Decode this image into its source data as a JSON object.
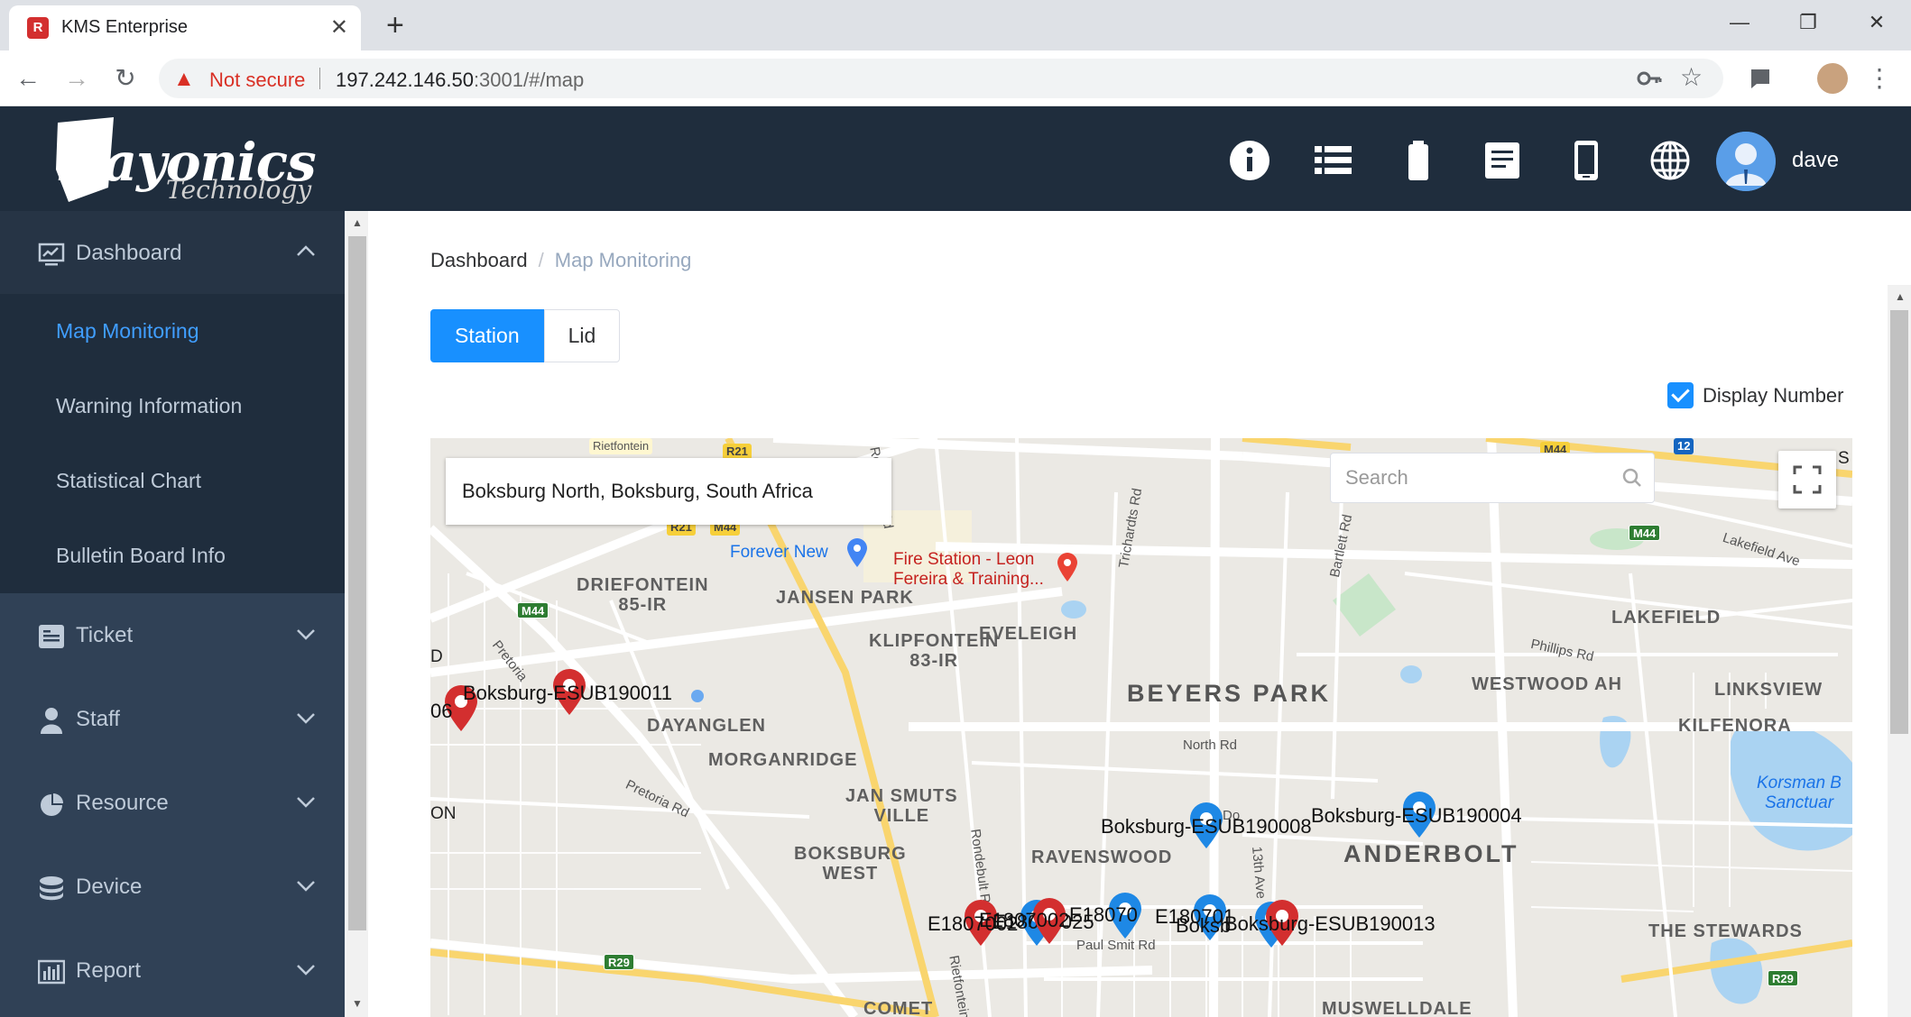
{
  "browser": {
    "tab_title": "KMS Enterprise",
    "tab_favicon_letter": "R",
    "security_label": "Not secure",
    "url_host": "197.242.146.50",
    "url_rest": ":3001/#/map",
    "window_minimize": "—",
    "window_restore": "❐",
    "window_close": "✕"
  },
  "header": {
    "logo_main": "Rayonics",
    "logo_sub": "Technology",
    "user_name": "dave",
    "icons": [
      "info-icon",
      "list-icon",
      "battery-icon",
      "document-icon",
      "mobile-icon",
      "globe-icon"
    ]
  },
  "sidebar": {
    "dashboard": {
      "label": "Dashboard",
      "items": [
        "Map Monitoring",
        "Warning Information",
        "Statistical Chart",
        "Bulletin Board Info"
      ]
    },
    "menus": [
      "Ticket",
      "Staff",
      "Resource",
      "Device",
      "Report"
    ]
  },
  "breadcrumb": {
    "home": "Dashboard",
    "sep": "/",
    "current": "Map Monitoring"
  },
  "view_tabs": {
    "station": "Station",
    "lid": "Lid"
  },
  "display_number": {
    "label": "Display Number",
    "checked": true
  },
  "map": {
    "location": "Boksburg North, Boksburg, South Africa",
    "search_placeholder": "Search",
    "areas": {
      "rietfontein": "Rietfontein",
      "jansen_park": "JANSEN PARK",
      "driefontein": "DRIEFONTEIN\n85-IR",
      "klipfontein": "KLIPFONTEIN\n83-IR",
      "eveleigh": "EVELEIGH",
      "beyers_park": "BEYERS PARK",
      "westwood_ah": "WESTWOOD AH",
      "lakefield": "LAKEFIELD",
      "linksview": "LINKSVIEW",
      "kilfenora": "KILFENORA",
      "dayanglen": "DAYANGLEN",
      "morganridge": "MORGANRIDGE",
      "jan_smuts_ville": "JAN SMUTS\nVILLE",
      "boksburg_west": "BOKSBURG\nWEST",
      "ravenswood": "RAVENSWOOD",
      "anderbolt": "ANDERBOLT",
      "the_stewards": "THE STEWARDS",
      "comet": "COMET",
      "muswelldale": "MUSWELLDALE",
      "korsman": "Korsman B\nSanctuar",
      "edge_d": "D",
      "edge_on": "ON",
      "edge_s": "S"
    },
    "roads": {
      "rondebult1": "Rondebult Rd",
      "richards": "Trichardts Rd",
      "bartlett": "Bartlett Rd",
      "lakefield_ave": "Lakefield Ave",
      "phillips": "Phillips Rd",
      "north_rd": "North Rd",
      "pretoria1": "Pretoria",
      "pretoria2": "Pretoria Rd",
      "rondebult2": "Rondebult Rd",
      "thirteenth": "13th Ave",
      "paul_smit": "Paul Smit Rd",
      "do": "Do",
      "rietfontein_rd": "Rietfontein"
    },
    "shields": [
      "R21",
      "R21",
      "M44",
      "M44",
      "M44",
      "M44",
      "R29",
      "R29",
      "12"
    ],
    "pois": {
      "forever_new": "Forever New",
      "fire_station": "Fire Station - Leon\nFereira & Training..."
    },
    "markers": [
      {
        "label": "Boksburg-ESUB190011",
        "color": "#d32f2f"
      },
      {
        "label": "06",
        "color": "#d32f2f"
      },
      {
        "label": "Boksburg-ESUB190008",
        "color": "#1e88e5"
      },
      {
        "label": "Boksburg-ESUB190004",
        "color": "#1e88e5"
      },
      {
        "label": "E1807002",
        "color": "#d32f2f"
      },
      {
        "label": "E18070025",
        "color": "#1e88e5"
      },
      {
        "label": "E1807002",
        "color": "#d32f2f"
      },
      {
        "label": "E18070",
        "color": "#1e88e5"
      },
      {
        "label": "E180701",
        "color": "#1e88e5"
      },
      {
        "label": "Boksburg-ESUB190013",
        "color": "#d32f2f"
      },
      {
        "label": "Boksb",
        "color": "#1e88e5"
      }
    ]
  }
}
